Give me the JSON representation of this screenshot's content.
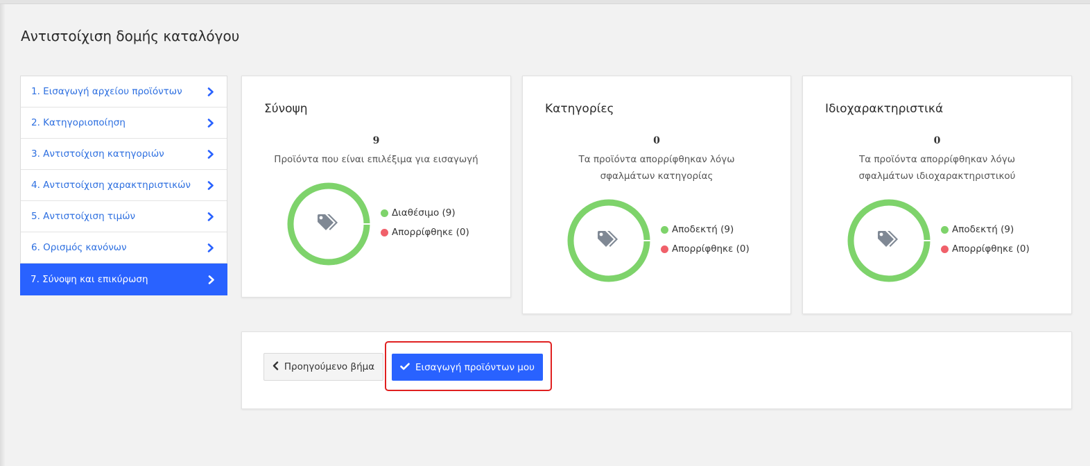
{
  "page": {
    "title": "Αντιστοίχιση δομής καταλόγου"
  },
  "steps": [
    {
      "label": "1. Εισαγωγή αρχείου προϊόντων",
      "active": false
    },
    {
      "label": "2. Κατηγοριοποίηση",
      "active": false
    },
    {
      "label": "3. Αντιστοίχιση κατηγοριών",
      "active": false
    },
    {
      "label": "4. Αντιστοίχιση χαρακτηριστικών",
      "active": false
    },
    {
      "label": "5. Αντιστοίχιση τιμών",
      "active": false
    },
    {
      "label": "6. Ορισμός κανόνων",
      "active": false
    },
    {
      "label": "7. Σύνοψη και επικύρωση",
      "active": true
    }
  ],
  "cards": {
    "summary": {
      "title": "Σύνοψη",
      "count": "9",
      "description": "Προϊόντα που είναι επιλέξιμα για εισαγωγή",
      "legend": [
        {
          "label": "Διαθέσιμο (9)",
          "color": "#7ed36b"
        },
        {
          "label": "Απορρίφθηκε (0)",
          "color": "#f0606a"
        }
      ]
    },
    "categories": {
      "title": "Κατηγορίες",
      "count": "0",
      "description": "Τα προϊόντα απορρίφθηκαν λόγω σφαλμάτων κατηγορίας",
      "legend": [
        {
          "label": "Αποδεκτή (9)",
          "color": "#7ed36b"
        },
        {
          "label": "Απορρίφθηκε (0)",
          "color": "#f0606a"
        }
      ]
    },
    "attributes": {
      "title": "Ιδιοχαρακτηριστικά",
      "count": "0",
      "description": "Τα προϊόντα απορρίφθηκαν λόγω σφαλμάτων ιδιοχαρακτηριστικού",
      "legend": [
        {
          "label": "Αποδεκτή (9)",
          "color": "#7ed36b"
        },
        {
          "label": "Απορρίφθηκε (0)",
          "color": "#f0606a"
        }
      ]
    }
  },
  "actions": {
    "prev_label": "Προηγούμενο βήμα",
    "import_label": "Εισαγωγή προϊόντων μου"
  },
  "colors": {
    "accent": "#2962ff",
    "link": "#2d6fe0",
    "accepted": "#7ed36b",
    "rejected": "#f0606a",
    "highlight": "#e02020"
  },
  "icons": {
    "step": "chevron-right-icon",
    "donut": "tags-icon",
    "prev": "chevron-left-icon",
    "import": "check-icon"
  }
}
